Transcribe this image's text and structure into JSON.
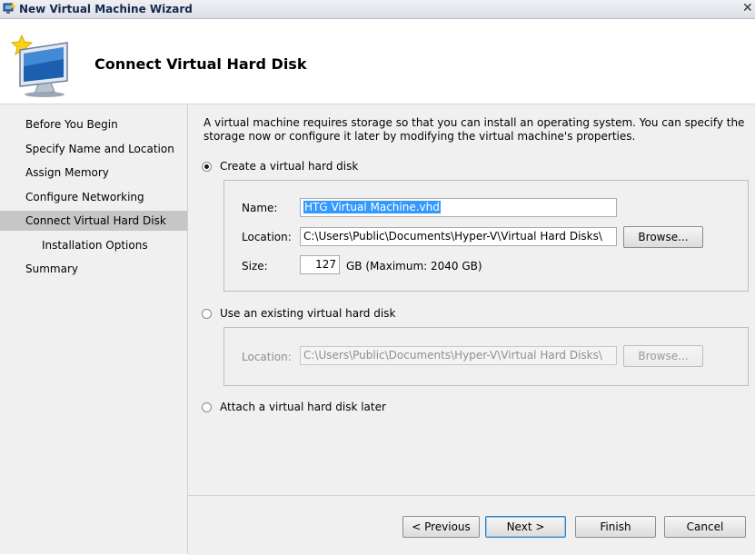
{
  "window": {
    "title": "New Virtual Machine Wizard",
    "close_glyph": "✕"
  },
  "header": {
    "heading": "Connect Virtual Hard Disk"
  },
  "nav": {
    "items": [
      {
        "label": "Before You Begin"
      },
      {
        "label": "Specify Name and Location"
      },
      {
        "label": "Assign Memory"
      },
      {
        "label": "Configure Networking"
      },
      {
        "label": "Connect Virtual Hard Disk",
        "active": true
      },
      {
        "label": "Installation Options",
        "sub": true
      },
      {
        "label": "Summary"
      }
    ]
  },
  "main": {
    "description": "A virtual machine requires storage so that you can install an operating system. You can specify the storage now or configure it later by modifying the virtual machine's properties.",
    "create": {
      "option_label": "Create a virtual hard disk",
      "selected": true,
      "name_label": "Name:",
      "name_value": "HTG Virtual Machine.vhd",
      "location_label": "Location:",
      "location_value": "C:\\Users\\Public\\Documents\\Hyper-V\\Virtual Hard Disks\\",
      "browse_label": "Browse...",
      "size_label": "Size:",
      "size_value": "127",
      "size_suffix": "GB (Maximum: 2040 GB)"
    },
    "existing": {
      "option_label": "Use an existing virtual hard disk",
      "location_label": "Location:",
      "location_value": "C:\\Users\\Public\\Documents\\Hyper-V\\Virtual Hard Disks\\",
      "browse_label": "Browse..."
    },
    "later": {
      "option_label": "Attach a virtual hard disk later"
    }
  },
  "footer": {
    "previous_label": "< Previous",
    "next_label": "Next >",
    "finish_label": "Finish",
    "cancel_label": "Cancel"
  },
  "icons": {
    "app": "hyper-v-wizard-icon",
    "header": "new-virtual-machine-icon",
    "close": "close-icon"
  }
}
